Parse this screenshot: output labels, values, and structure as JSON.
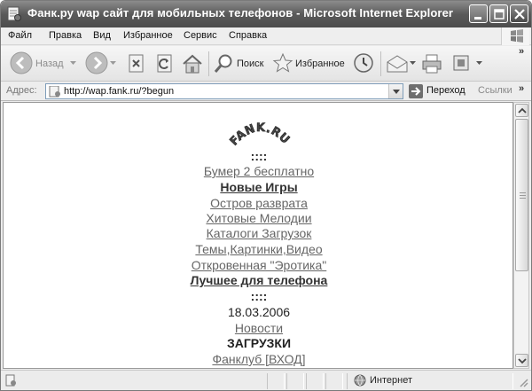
{
  "window": {
    "title": "Фанк.ру wap сайт для мобильных телефонов - Microsoft Internet Explorer"
  },
  "menu": {
    "items": [
      {
        "label": "Файл"
      },
      {
        "label": "Правка"
      },
      {
        "label": "Вид"
      },
      {
        "label": "Избранное"
      },
      {
        "label": "Сервис"
      },
      {
        "label": "Справка"
      }
    ]
  },
  "toolbar": {
    "back_label": "Назад",
    "search_label": "Поиск",
    "favorites_label": "Избранное",
    "overflow": "»"
  },
  "address": {
    "label": "Адрес:",
    "url": "http://wap.fank.ru/?begun",
    "go_label": "Переход",
    "links_label": "Ссылки",
    "overflow": "»"
  },
  "page": {
    "logo_text": "FANK.RU",
    "separator_top": "::::",
    "lines": [
      {
        "text": "Бумер 2 бесплатно",
        "style": "link"
      },
      {
        "text": "Новые Игры",
        "style": "bold"
      },
      {
        "text": "Остров разврата",
        "style": "link"
      },
      {
        "text": "Хитовые Мелодии",
        "style": "link"
      },
      {
        "text": "Каталоги Загрузок",
        "style": "link"
      },
      {
        "text": "Темы,Картинки,Видео",
        "style": "link"
      },
      {
        "text": "Откровенная \"Эротика\"",
        "style": "link"
      },
      {
        "text": "Лучшее для телефона",
        "style": "bold"
      }
    ],
    "separator_mid": "::::",
    "date": "18.03.2006",
    "news": "Новости",
    "downloads": "ЗАГРУЗКИ",
    "fanclub": "Фанклуб [ВХОД]"
  },
  "status": {
    "zone": "Интернет"
  },
  "colors": {
    "titlebar": "#5a5a5a",
    "link": "#666666",
    "content_bg": "#ffffff"
  }
}
